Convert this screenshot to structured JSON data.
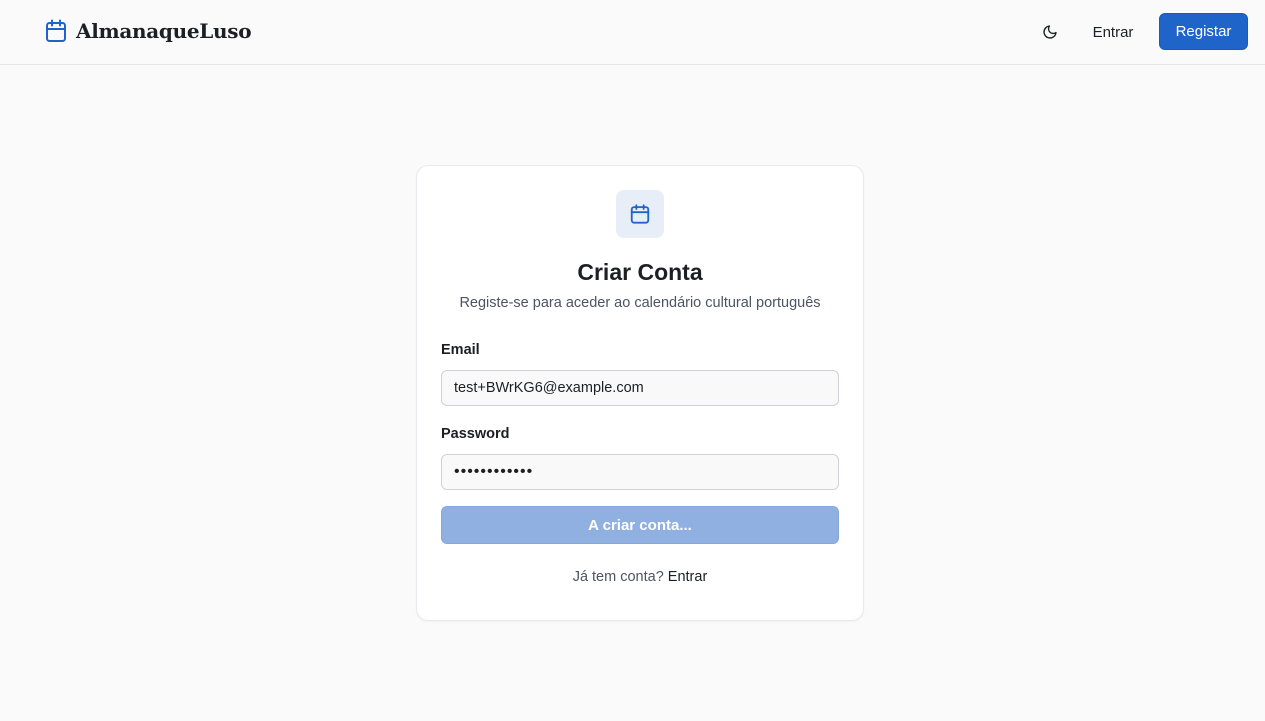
{
  "header": {
    "brand": "AlmanaqueLuso",
    "brand_icon": "calendar-icon",
    "theme_icon": "moon-icon",
    "login_label": "Entrar",
    "register_label": "Registar"
  },
  "form": {
    "icon": "calendar-icon",
    "title": "Criar Conta",
    "subtitle": "Registe-se para aceder ao calendário cultural português",
    "email_label": "Email",
    "email_value": "test+BWrKG6@example.com",
    "password_label": "Password",
    "password_value": "••••••••••••",
    "submit_label": "A criar conta...",
    "signin_prompt": "Já tem conta?",
    "signin_link": "Entrar"
  },
  "colors": {
    "accent": "#1f65c9",
    "button_disabled": "#8fb0e1",
    "page_background": "#fafafa",
    "card_background": "#ffffff",
    "icon_tile": "#e8eef8"
  }
}
